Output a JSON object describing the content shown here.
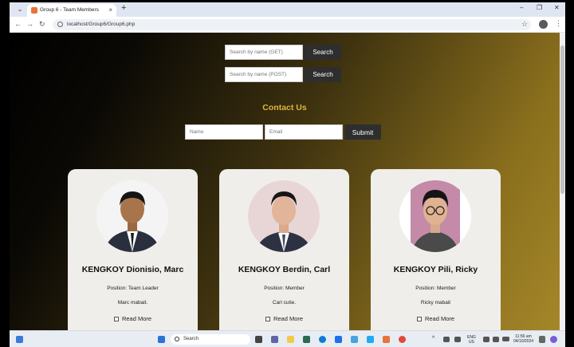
{
  "browser": {
    "tab_title": "Group 6 - Team Members",
    "tab_close": "×",
    "new_tab": "+",
    "url": "localhost/Group6/Group6.php",
    "minimize": "–",
    "maximize": "❐",
    "close": "✕"
  },
  "search": {
    "get_placeholder": "Search by name (GET)",
    "post_placeholder": "Search by name (POST)",
    "button_label": "Search"
  },
  "contact": {
    "title": "Contact Us",
    "name_placeholder": "Name",
    "email_placeholder": "Email",
    "submit_label": "Submit"
  },
  "members": [
    {
      "name": "KENGKOY Dionisio, Marc",
      "position": "Position: Team Leader",
      "description": "Marc mabait.",
      "more": "Read More"
    },
    {
      "name": "KENGKOY Berdin, Carl",
      "position": "Position: Member",
      "description": "Carl cutie.",
      "more": "Read More"
    },
    {
      "name": "KENGKOY Pili, Ricky",
      "position": "Position: Member",
      "description": "Ricky mabait",
      "more": "Read More"
    }
  ],
  "taskbar": {
    "search_label": "Search",
    "lang_top": "ENG",
    "lang_bottom": "US",
    "time": "11:56 am",
    "date": "04/10/2024"
  },
  "colors": {
    "accent_gold": "#e0b43c",
    "button_dark": "#2e2e2e",
    "card_bg": "#efeeea"
  }
}
